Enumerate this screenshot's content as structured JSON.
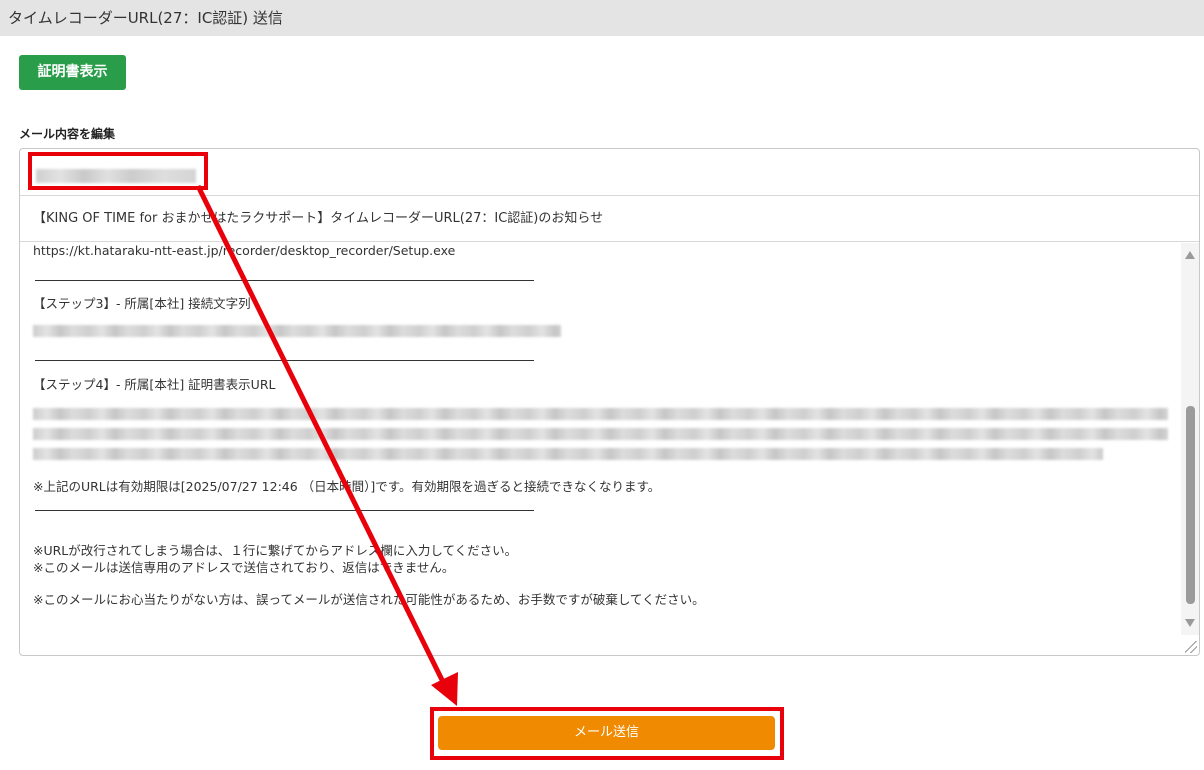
{
  "window": {
    "title": "タイムレコーダーURL(27：IC認証) 送信"
  },
  "toolbar": {
    "cert_button_label": "証明書表示"
  },
  "editor": {
    "section_label": "メール内容を編集",
    "subject": "【KING OF TIME for おまかせはたラクサポート】タイムレコーダーURL(27：IC認証)のお知らせ",
    "body": {
      "setup_url": "https://kt.hataraku-ntt-east.jp/recorder/desktop_recorder/Setup.exe",
      "step3_heading": "【ステップ3】- 所属[本社] 接続文字列",
      "step4_heading": "【ステップ4】- 所属[本社] 証明書表示URL",
      "expiry_note": "※上記のURLは有効期限は[2025/07/27 12:46 （日本時間）]です。有効期限を過ぎると接続できなくなります。",
      "note1": "※URLが改行されてしまう場合は、１行に繋げてからアドレス欄に入力してください。",
      "note2": "※このメールは送信専用のアドレスで送信されており、返信はできません。",
      "note3": "※このメールにお心当たりがない方は、誤ってメールが送信された可能性があるため、お手数ですが破棄してください。"
    }
  },
  "footer": {
    "send_button_label": "メール送信"
  },
  "colors": {
    "primary_green": "#2a9d4a",
    "send_orange": "#f08a00",
    "annotation_red": "#e8000b"
  }
}
